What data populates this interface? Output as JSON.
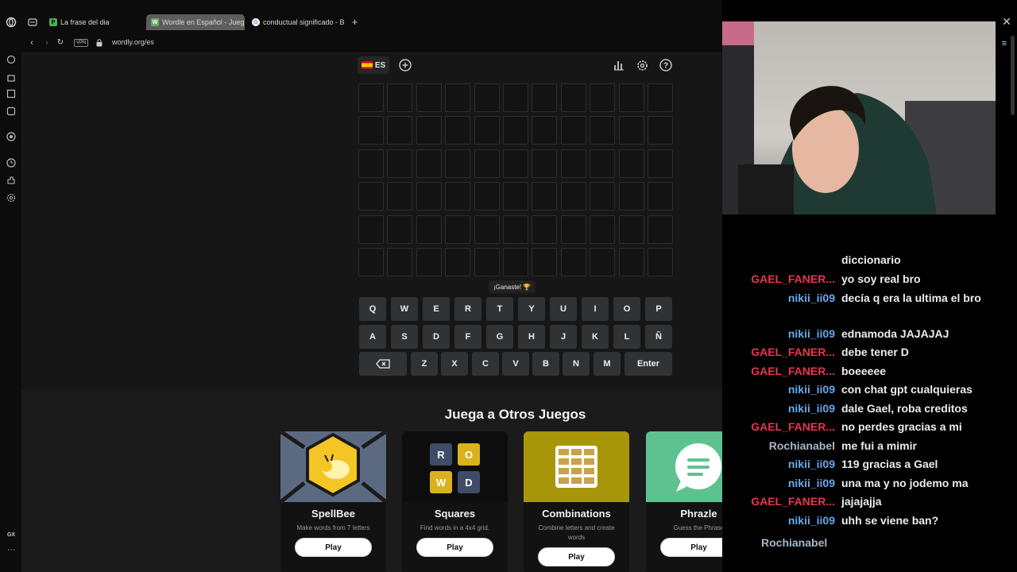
{
  "browser": {
    "tabs": [
      {
        "title": "La frase del dia",
        "favicon_letter": "P",
        "favicon_color": "#4caf50"
      },
      {
        "title": "Wordle en Español - Jueg",
        "favicon_letter": "W",
        "favicon_color": "#6aaa64",
        "active": true
      },
      {
        "title": "conductual significado - B",
        "favicon_letter": "G",
        "favicon_color": "#ffffff"
      }
    ],
    "vpn_label": "VPN",
    "url": "wordly.org/es",
    "sidebar_footer": "GX"
  },
  "wordle": {
    "language": "ES",
    "flag_colors": [
      "#c60b1e",
      "#ffc400"
    ],
    "rows": 6,
    "columns": 11,
    "toast": "¡Ganaste! 🏆",
    "keyboard": {
      "row1": [
        "Q",
        "W",
        "E",
        "R",
        "T",
        "Y",
        "U",
        "I",
        "O",
        "P"
      ],
      "row2": [
        "A",
        "S",
        "D",
        "F",
        "G",
        "H",
        "J",
        "K",
        "L",
        "Ñ"
      ],
      "row3": [
        "Z",
        "X",
        "C",
        "V",
        "B",
        "N",
        "M"
      ],
      "enter": "Enter"
    }
  },
  "other_games": {
    "title": "Juega a Otros Juegos",
    "cards": [
      {
        "name": "SpellBee",
        "desc": "Make words from 7 letters",
        "play": "Play",
        "color": "#5b6a80"
      },
      {
        "name": "Squares",
        "desc": "Find words in a 4x4 grid.",
        "play": "Play",
        "color": "#111111",
        "letters": [
          "R",
          "O",
          "W",
          "D"
        ]
      },
      {
        "name": "Combinations",
        "desc": "Combine letters and create words",
        "play": "Play",
        "color": "#a8960a"
      },
      {
        "name": "Phrazle",
        "desc": "Guess the Phrase",
        "play": "Play",
        "color": "#5ec290"
      }
    ]
  },
  "chat": [
    {
      "user": "",
      "msg": "diccionario",
      "color": "#e8354f"
    },
    {
      "user": "GAEL_FANER...",
      "msg": "yo soy real bro",
      "color": "#e8354f"
    },
    {
      "user": "nikii_ii09",
      "msg": "decía q era la ultima el bro",
      "color": "#6aa8ec"
    },
    {
      "user": "nikii_ii09",
      "msg": "ednamoda JAJAJAJ",
      "color": "#6aa8ec"
    },
    {
      "user": "GAEL_FANER...",
      "msg": "debe tener D",
      "color": "#e8354f"
    },
    {
      "user": "GAEL_FANER...",
      "msg": "boeeeee",
      "color": "#e8354f"
    },
    {
      "user": "nikii_ii09",
      "msg": "con chat gpt cualquieras",
      "color": "#6aa8ec"
    },
    {
      "user": "nikii_ii09",
      "msg": "dale Gael, roba creditos",
      "color": "#6aa8ec"
    },
    {
      "user": "GAEL_FANER...",
      "msg": "no perdes gracias a mi",
      "color": "#e8354f"
    },
    {
      "user": "Rochianabel",
      "msg": "me fui a mimir",
      "color": "#a7b7c7"
    },
    {
      "user": "nikii_ii09",
      "msg": "119 gracias a Gael",
      "color": "#6aa8ec"
    },
    {
      "user": "nikii_ii09",
      "msg": "una ma y no jodemo ma",
      "color": "#6aa8ec"
    },
    {
      "user": "GAEL_FANER...",
      "msg": "jajajajja",
      "color": "#e8354f"
    },
    {
      "user": "nikii_ii09",
      "msg": "uhh se viene ban?",
      "color": "#6aa8ec"
    },
    {
      "user": "Rochianabel",
      "msg": "",
      "color": "#a7b7c7"
    }
  ]
}
